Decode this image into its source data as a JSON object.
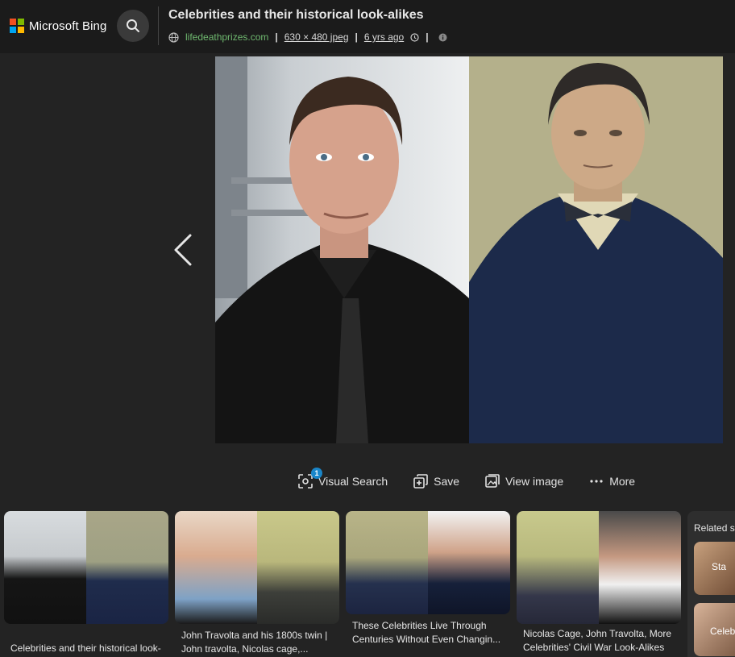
{
  "header": {
    "brand": "Microsoft Bing",
    "title": "Celebrities and their historical look-alikes",
    "source": "lifedeathprizes.com",
    "dimensions": "630 × 480 jpeg",
    "age": "6 yrs ago",
    "separator": "|"
  },
  "actions": {
    "visual_search": "Visual Search",
    "visual_search_badge": "1",
    "save": "Save",
    "view_image": "View image",
    "more": "More"
  },
  "thumbnails": [
    {
      "caption_1": "Celebrities and their historical look-",
      "caption_2": ""
    },
    {
      "caption_1": "John Travolta and his 1800s twin |",
      "caption_2": "John travolta, Nicolas cage,..."
    },
    {
      "caption_1": "These Celebrities Live Through",
      "caption_2": "Centuries Without Even Changin..."
    },
    {
      "caption_1": "Nicolas Cage, John Travolta, More",
      "caption_2": "Celebrities' Civil War Look-Alikes"
    }
  ],
  "related": {
    "title": "Related s",
    "item_1": "Sta",
    "item_2": "Celeb"
  },
  "colors": {
    "ms_red": "#f25022",
    "ms_green": "#7fba00",
    "ms_blue": "#00a4ef",
    "ms_yellow": "#ffb900",
    "source_link": "#6fb86f",
    "badge": "#1a86c9"
  }
}
